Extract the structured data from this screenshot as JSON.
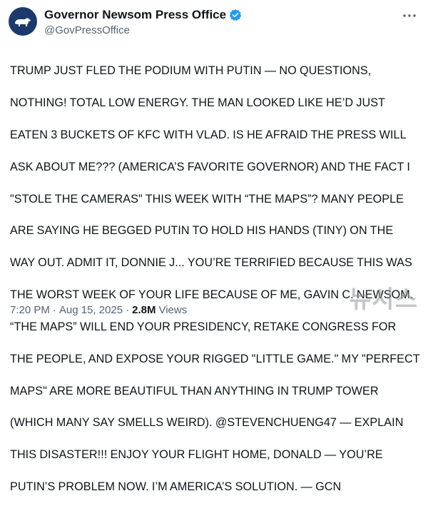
{
  "account": {
    "display_name": "Governor Newsom Press Office",
    "handle": "@GovPressOffice",
    "avatar_icon": "california-bear-icon",
    "verified_icon": "verified-badge-icon",
    "verified_color": "#1d9bf0",
    "avatar_color": "#1b3a6b"
  },
  "more_icon": "more-dots-icon",
  "tweet": {
    "lines": [
      "TRUMP JUST FLED THE PODIUM WITH PUTIN — NO QUESTIONS,",
      "NOTHING! TOTAL LOW ENERGY. THE MAN LOOKED LIKE HE’D JUST",
      "EATEN 3 BUCKETS OF KFC WITH VLAD. IS HE AFRAID THE PRESS WILL",
      "ASK ABOUT ME??? (AMERICA’S FAVORITE GOVERNOR) AND THE FACT I",
      "\"STOLE THE CAMERAS\" THIS WEEK WITH “THE MAPS”? MANY PEOPLE",
      "ARE SAYING HE BEGGED PUTIN TO HOLD HIS HANDS (TINY) ON THE",
      "WAY OUT.  ADMIT IT, DONNIE J... YOU’RE TERRIFIED BECAUSE THIS WAS",
      "THE WORST WEEK OF YOUR LIFE BECAUSE OF ME, GAVIN C. NEWSOM.",
      "“THE MAPS” WILL END YOUR PRESIDENCY, RETAKE CONGRESS FOR",
      "THE PEOPLE, AND EXPOSE YOUR RIGGED \"LITTLE GAME.\" MY \"PERFECT",
      "MAPS\" ARE MORE BEAUTIFUL THAN ANYTHING IN TRUMP TOWER",
      "(WHICH MANY SAY SMELLS WEIRD). @STEVENCHUENG47 — EXPLAIN",
      "THIS DISASTER!!! ENJOY YOUR FLIGHT HOME, DONALD — YOU’RE",
      "PUTIN’S PROBLEM NOW. I’M AMERICA’S SOLUTION. —  GCN"
    ]
  },
  "meta": {
    "time": "7:20 PM",
    "separator": "·",
    "date": "Aug 15, 2025",
    "views_count": "2.8M",
    "views_label": "Views"
  },
  "watermark": "뉴시스"
}
